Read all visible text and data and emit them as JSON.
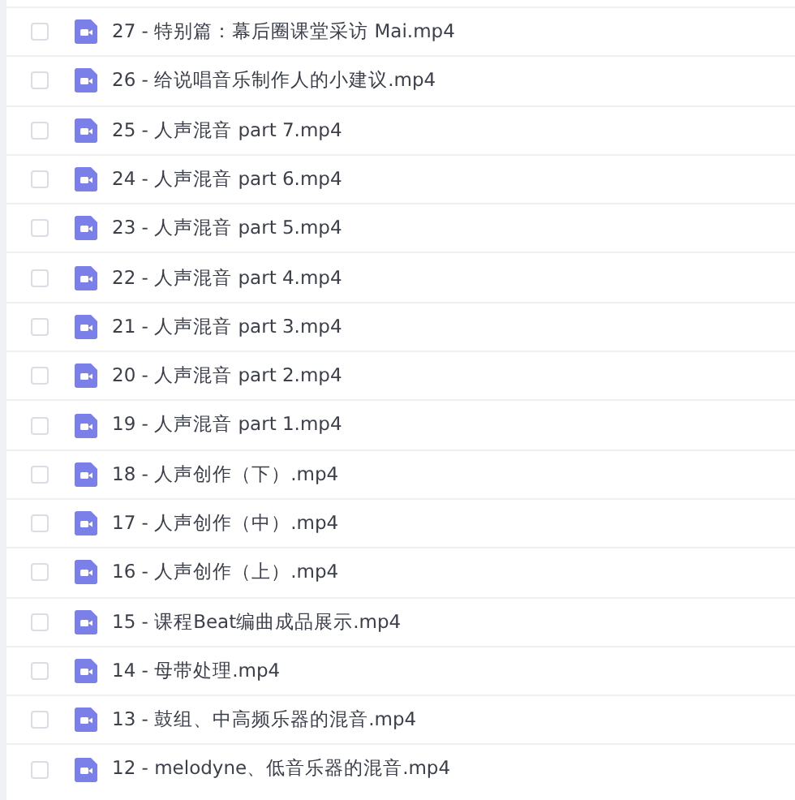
{
  "files": [
    {
      "name": "27 - 特别篇：幕后圈课堂采访 Mai.mp4",
      "checked": false
    },
    {
      "name": "26 - 给说唱音乐制作人的小建议.mp4",
      "checked": false
    },
    {
      "name": "25 - 人声混音 part 7.mp4",
      "checked": false
    },
    {
      "name": "24 - 人声混音 part 6.mp4",
      "checked": false
    },
    {
      "name": "23 - 人声混音 part 5.mp4",
      "checked": false
    },
    {
      "name": "22 - 人声混音 part 4.mp4",
      "checked": false
    },
    {
      "name": "21 - 人声混音 part 3.mp4",
      "checked": false
    },
    {
      "name": "20 - 人声混音 part 2.mp4",
      "checked": false
    },
    {
      "name": "19 - 人声混音 part 1.mp4",
      "checked": false
    },
    {
      "name": "18 - 人声创作（下）.mp4",
      "checked": false
    },
    {
      "name": "17 - 人声创作（中）.mp4",
      "checked": false
    },
    {
      "name": "16 - 人声创作（上）.mp4",
      "checked": false
    },
    {
      "name": "15 - 课程Beat编曲成品展示.mp4",
      "checked": false
    },
    {
      "name": "14 - 母带处理.mp4",
      "checked": false
    },
    {
      "name": "13 - 鼓组、中高频乐器的混音.mp4",
      "checked": false
    },
    {
      "name": "12 - melodyne、低音乐器的混音.mp4",
      "checked": false
    }
  ]
}
